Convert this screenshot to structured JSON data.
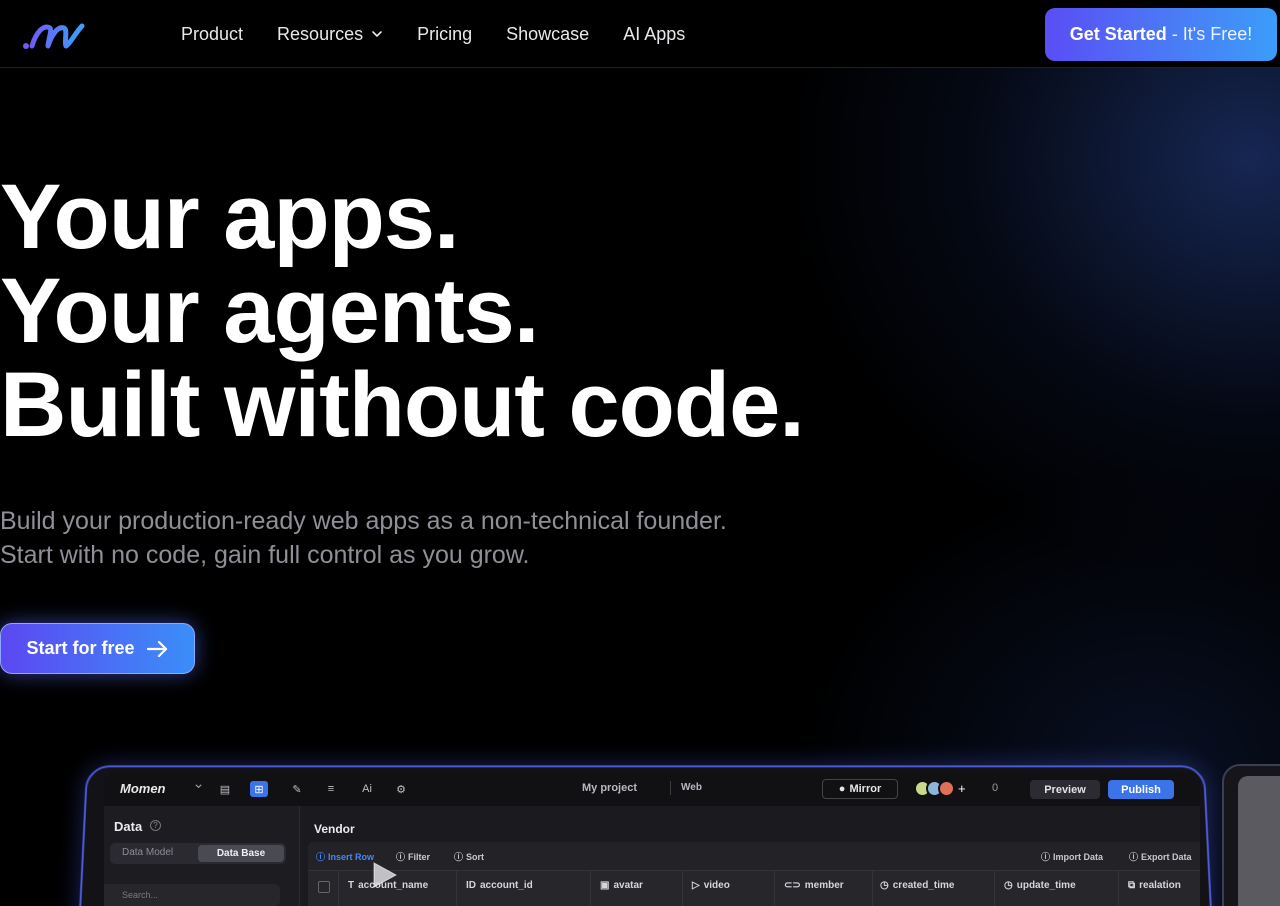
{
  "nav": {
    "links": [
      {
        "label": "Product"
      },
      {
        "label": "Resources"
      },
      {
        "label": "Pricing"
      },
      {
        "label": "Showcase"
      },
      {
        "label": "AI Apps"
      }
    ],
    "cta_strong": "Get Started",
    "cta_light": "- It's Free!"
  },
  "hero": {
    "line1": "Your apps.",
    "line2": "Your agents.",
    "line3": "Built without code.",
    "sub1": "Build your production-ready web apps as a non-technical founder.",
    "sub2": "Start with no code, gain full control as you grow.",
    "start_label": "Start for free"
  },
  "app": {
    "logo": "Momen",
    "project": "My project",
    "platform": "Web",
    "mirror": "Mirror",
    "counter": "0",
    "preview": "Preview",
    "publish": "Publish",
    "sidebar_title": "Data",
    "seg_model": "Data Model",
    "seg_base": "Data Base",
    "search_placeholder": "Search...",
    "table_title": "Vendor",
    "toolbar": {
      "insert": "Insert Row",
      "filter": "Filter",
      "sort": "Sort",
      "import": "Import Data",
      "export": "Export Data"
    },
    "columns": [
      {
        "label": "account_name"
      },
      {
        "label": "account_id"
      },
      {
        "label": "avatar"
      },
      {
        "label": "video"
      },
      {
        "label": "member"
      },
      {
        "label": "created_time"
      },
      {
        "label": "update_time"
      },
      {
        "label": "realation"
      }
    ]
  },
  "colors": {
    "accent": "#3a74e8",
    "cta_start": "#5a4df5",
    "cta_end": "#3b9dfa",
    "background": "#000000"
  }
}
